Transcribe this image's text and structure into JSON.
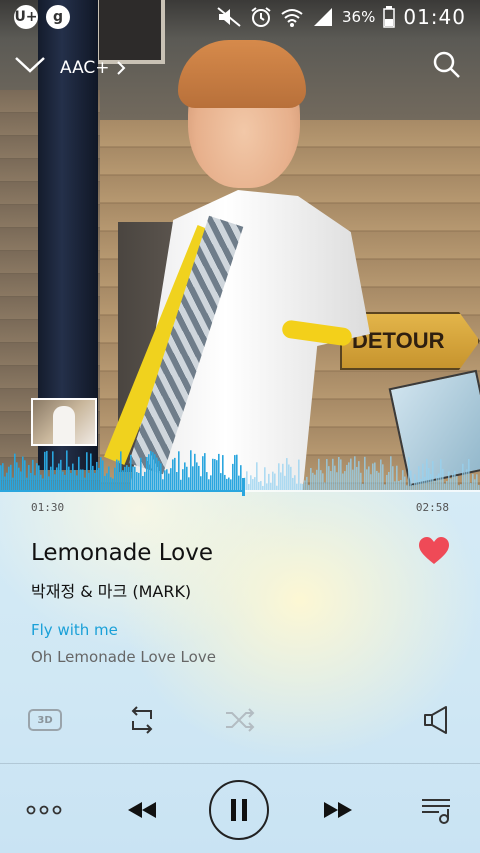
{
  "status_bar": {
    "left_icons": [
      "U+",
      "g"
    ],
    "battery": "36%",
    "time": "01:40"
  },
  "top": {
    "aac_label": "AAC+",
    "icons": [
      "chevron-down-icon",
      "chevron-right-icon",
      "search-icon"
    ]
  },
  "progress": {
    "elapsed": "01:30",
    "total": "02:58",
    "fraction": 0.506
  },
  "song": {
    "title": "Lemonade Love",
    "artist": "박재정 & 마크 (MARK)",
    "liked": true
  },
  "lyrics": {
    "current": "Fly with me",
    "next": "Oh Lemonade Love Love"
  },
  "controls": {
    "three_d_label": "3D",
    "icons": [
      "3d-icon",
      "repeat-icon",
      "shuffle-icon",
      "speaker-icon"
    ]
  },
  "transport": {
    "icons": [
      "more-icon",
      "previous-icon",
      "pause-icon",
      "next-icon",
      "playlist-icon"
    ]
  },
  "colors": {
    "accent": "#2aa6de",
    "heart": "#ef4a57",
    "lyric_highlight": "#1aa0d8"
  }
}
